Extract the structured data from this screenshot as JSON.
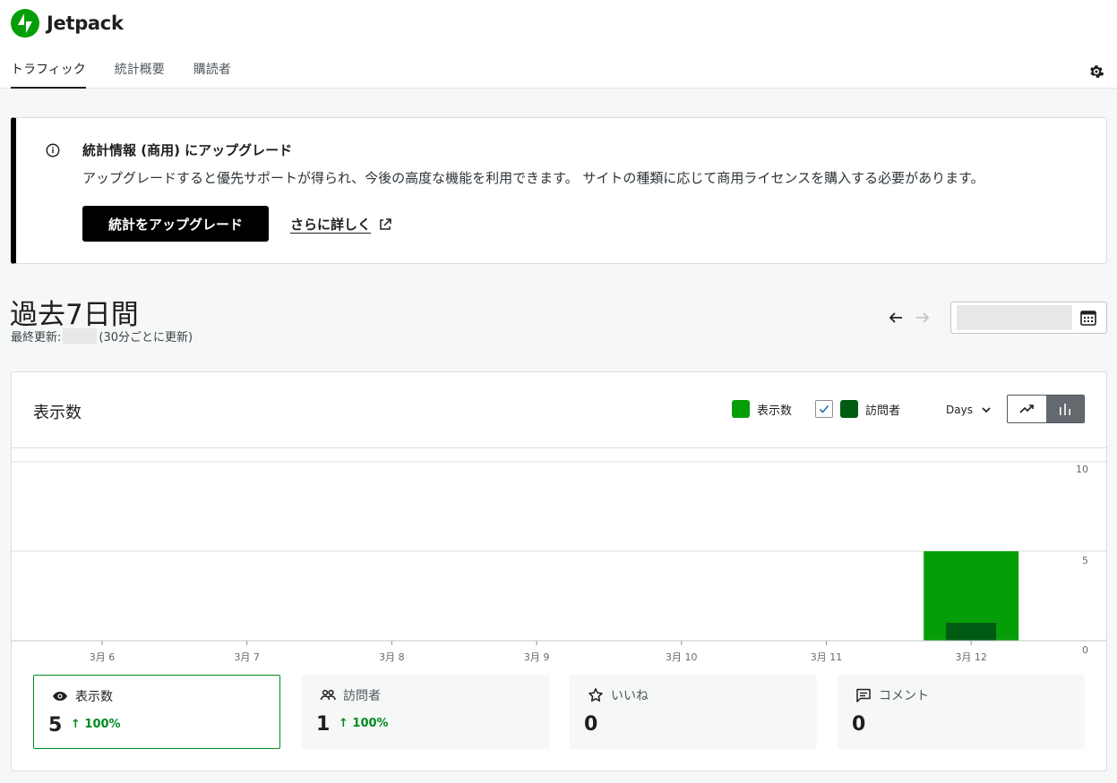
{
  "brand": {
    "name": "Jetpack",
    "color": "#069e08"
  },
  "tabs": [
    {
      "label": "トラフィック",
      "active": true
    },
    {
      "label": "統計概要",
      "active": false
    },
    {
      "label": "購読者",
      "active": false
    }
  ],
  "notice": {
    "title": "統計情報 (商用) にアップグレード",
    "body": "アップグレードすると優先サポートが得られ、今後の高度な機能を利用できます。 サイトの種類に応じて商用ライセンスを購入する必要があります。",
    "upgrade_button": "統計をアップグレード",
    "learn_more": "さらに詳しく"
  },
  "period": {
    "title": "過去7日間",
    "last_updated_prefix": "最終更新:",
    "last_updated_suffix": "(30分ごとに更新)"
  },
  "chart_card": {
    "title": "表示数",
    "legend_views": "表示数",
    "legend_visitors": "訪問者",
    "visitors_checked": true,
    "period_select": "Days",
    "chart_view": "bar"
  },
  "chart_data": {
    "type": "bar",
    "categories": [
      "3月 6",
      "3月 7",
      "3月 8",
      "3月 9",
      "3月 10",
      "3月 11",
      "3月 12"
    ],
    "series": [
      {
        "name": "表示数",
        "values": [
          0,
          0,
          0,
          0,
          0,
          0,
          5
        ],
        "color": "#069e08"
      },
      {
        "name": "訪問者",
        "values": [
          0,
          0,
          0,
          0,
          0,
          0,
          1
        ],
        "color": "#005c12"
      }
    ],
    "ylim": [
      0,
      10
    ],
    "yticks": [
      "0",
      "5",
      "10"
    ],
    "grid": true
  },
  "stats": [
    {
      "label": "表示数",
      "icon": "eye-icon",
      "value": "5",
      "delta": "↑ 100%",
      "active": true
    },
    {
      "label": "訪問者",
      "icon": "people-icon",
      "value": "1",
      "delta": "↑ 100%",
      "active": false
    },
    {
      "label": "いいね",
      "icon": "star-icon",
      "value": "0",
      "delta": "",
      "active": false
    },
    {
      "label": "コメント",
      "icon": "comment-icon",
      "value": "0",
      "delta": "",
      "active": false
    }
  ]
}
